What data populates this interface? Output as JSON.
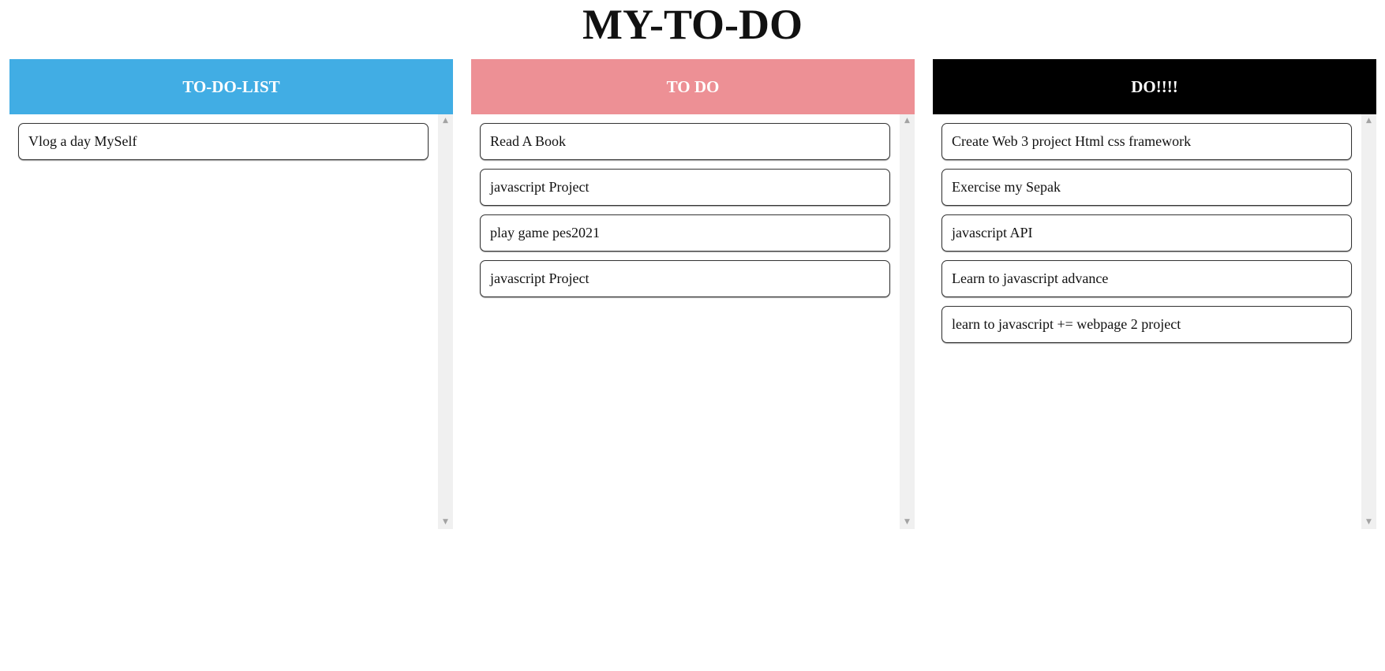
{
  "page": {
    "title": "MY-TO-DO"
  },
  "columns": [
    {
      "title": "TO-DO-LIST",
      "color": "#41ade4",
      "items": [
        "Vlog a day MySelf"
      ]
    },
    {
      "title": "TO DO",
      "color": "#ed9095",
      "items": [
        "Read A Book",
        "javascript Project",
        "play game pes2021",
        "javascript Project"
      ]
    },
    {
      "title": "DO!!!!",
      "color": "#000000",
      "items": [
        "Create Web 3 project Html css framework",
        "Exercise my Sepak",
        "javascript API",
        "Learn to javascript advance",
        "learn to javascript += webpage 2 project"
      ]
    }
  ],
  "icons": {
    "scroll_up": "scroll-up-arrow-icon",
    "scroll_down": "scroll-down-arrow-icon"
  }
}
